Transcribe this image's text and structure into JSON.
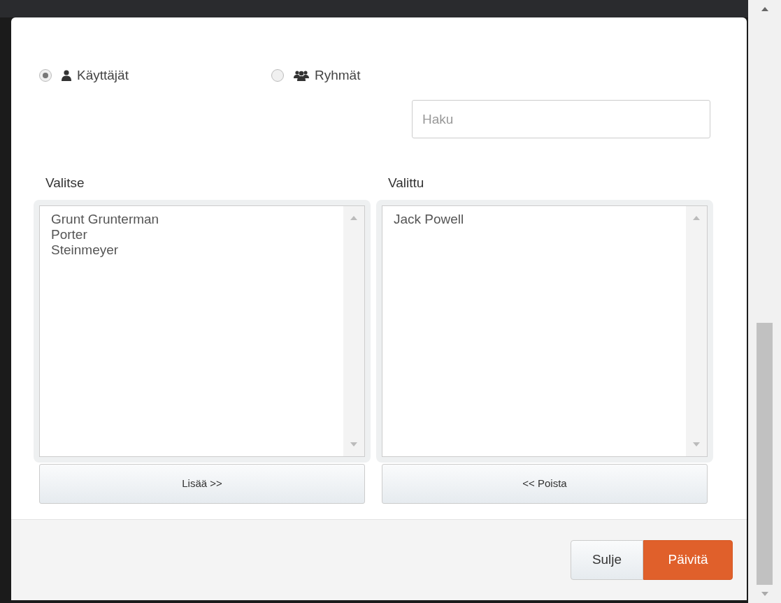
{
  "radios": [
    {
      "label": "Käyttäjät",
      "selected": true
    },
    {
      "label": "Ryhmät",
      "selected": false
    }
  ],
  "search": {
    "placeholder": "Haku"
  },
  "lists": [
    {
      "title": "Valitse",
      "items": [
        "Grunt Grunterman",
        "Porter",
        "Steinmeyer"
      ],
      "button": "Lisää >>"
    },
    {
      "title": "Valittu",
      "items": [
        "Jack Powell"
      ],
      "button": "<< Poista"
    }
  ],
  "footer_buttons": [
    {
      "label": "Sulje",
      "kind": "default"
    },
    {
      "label": "Päivitä",
      "kind": "primary"
    }
  ]
}
